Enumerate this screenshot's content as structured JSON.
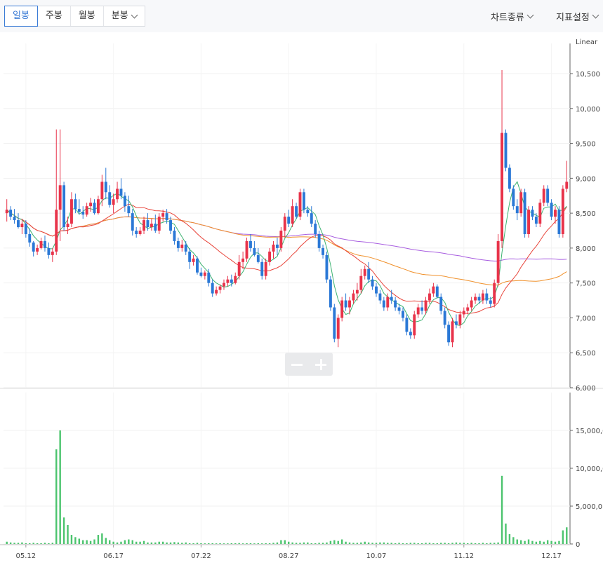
{
  "tabs": [
    {
      "label": "일봉",
      "active": true
    },
    {
      "label": "주봉",
      "active": false
    },
    {
      "label": "월봉",
      "active": false
    },
    {
      "label": "분봉",
      "active": false,
      "dropdown": true
    }
  ],
  "menus": {
    "chart_type": "차트종류",
    "indicator_settings": "지표설정"
  },
  "colors": {
    "up": "#e8334a",
    "down": "#2a78d6",
    "ma5": "#3cb371",
    "ma20": "#e8443a",
    "ma60": "#f0902a",
    "ma120": "#a85ee0",
    "volume": "#4cc46e"
  },
  "chart_data": {
    "type": "candlestick",
    "scale_label": "Linear",
    "price_axis": {
      "min": 6000,
      "max": 10500,
      "ticks": [
        "6,000",
        "6,500",
        "7,000",
        "7,500",
        "8,000",
        "8,500",
        "9,000",
        "9,500",
        "10,000",
        "10,500"
      ]
    },
    "volume_axis": {
      "min": 0,
      "max": 15000,
      "ticks": [
        "0",
        "5,000,0",
        "10,000,0",
        "15,000,0"
      ]
    },
    "x_ticks": [
      "05.12",
      "06.17",
      "07.22",
      "08.27",
      "10.07",
      "11.12",
      "12.17"
    ],
    "candles": [
      [
        8500,
        8700,
        8380,
        8550
      ],
      [
        8550,
        8600,
        8400,
        8450
      ],
      [
        8450,
        8560,
        8350,
        8400
      ],
      [
        8400,
        8500,
        8280,
        8300
      ],
      [
        8300,
        8420,
        8200,
        8350
      ],
      [
        8350,
        8400,
        8150,
        8200
      ],
      [
        8200,
        8280,
        8020,
        8080
      ],
      [
        8080,
        8100,
        7880,
        7950
      ],
      [
        7950,
        8050,
        7900,
        8000
      ],
      [
        8000,
        8150,
        7980,
        8100
      ],
      [
        8100,
        8180,
        7950,
        8000
      ],
      [
        8000,
        8080,
        7850,
        7900
      ],
      [
        7900,
        8000,
        7800,
        7950
      ],
      [
        7950,
        9700,
        7900,
        8550
      ],
      [
        8550,
        9700,
        8100,
        8900
      ],
      [
        8900,
        8950,
        8250,
        8300
      ],
      [
        8300,
        8450,
        8200,
        8350
      ],
      [
        8350,
        8800,
        8300,
        8700
      ],
      [
        8700,
        8780,
        8500,
        8560
      ],
      [
        8560,
        8700,
        8480,
        8520
      ],
      [
        8520,
        8600,
        8420,
        8480
      ],
      [
        8480,
        8650,
        8450,
        8600
      ],
      [
        8600,
        8720,
        8520,
        8650
      ],
      [
        8650,
        8700,
        8480,
        8500
      ],
      [
        8500,
        8750,
        8480,
        8700
      ],
      [
        8700,
        9050,
        8600,
        8950
      ],
      [
        8950,
        9150,
        8700,
        8800
      ],
      [
        8800,
        8900,
        8580,
        8620
      ],
      [
        8620,
        8780,
        8500,
        8700
      ],
      [
        8700,
        8950,
        8650,
        8850
      ],
      [
        8850,
        9000,
        8700,
        8750
      ],
      [
        8750,
        8800,
        8520,
        8600
      ],
      [
        8600,
        8750,
        8450,
        8500
      ],
      [
        8500,
        8560,
        8180,
        8250
      ],
      [
        8250,
        8300,
        8150,
        8200
      ],
      [
        8200,
        8300,
        8180,
        8250
      ],
      [
        8250,
        8450,
        8200,
        8400
      ],
      [
        8400,
        8500,
        8250,
        8300
      ],
      [
        8300,
        8420,
        8250,
        8350
      ],
      [
        8350,
        8480,
        8220,
        8250
      ],
      [
        8250,
        8500,
        8200,
        8450
      ],
      [
        8450,
        8550,
        8380,
        8500
      ],
      [
        8500,
        8560,
        8350,
        8400
      ],
      [
        8400,
        8450,
        8200,
        8250
      ],
      [
        8250,
        8300,
        8050,
        8100
      ],
      [
        8100,
        8150,
        7950,
        8000
      ],
      [
        8000,
        8120,
        7950,
        8050
      ],
      [
        8050,
        8100,
        7900,
        7950
      ],
      [
        7950,
        8000,
        7700,
        7800
      ],
      [
        7800,
        7900,
        7750,
        7850
      ],
      [
        7850,
        7880,
        7620,
        7650
      ],
      [
        7650,
        7720,
        7580,
        7600
      ],
      [
        7600,
        7680,
        7550,
        7650
      ],
      [
        7650,
        7700,
        7450,
        7500
      ],
      [
        7500,
        7550,
        7300,
        7350
      ],
      [
        7350,
        7450,
        7320,
        7400
      ],
      [
        7400,
        7480,
        7350,
        7450
      ],
      [
        7450,
        7550,
        7400,
        7500
      ],
      [
        7500,
        7600,
        7450,
        7550
      ],
      [
        7550,
        7620,
        7450,
        7500
      ],
      [
        7500,
        7650,
        7480,
        7600
      ],
      [
        7600,
        7900,
        7550,
        7800
      ],
      [
        7800,
        7950,
        7700,
        7850
      ],
      [
        7850,
        8150,
        7800,
        8100
      ],
      [
        8100,
        8200,
        7950,
        8000
      ],
      [
        8000,
        8100,
        7880,
        7900
      ],
      [
        7900,
        8000,
        7780,
        7800
      ],
      [
        7800,
        7850,
        7550,
        7600
      ],
      [
        7600,
        7850,
        7550,
        7800
      ],
      [
        7800,
        8000,
        7750,
        7950
      ],
      [
        7950,
        8100,
        7850,
        8050
      ],
      [
        8050,
        8150,
        7900,
        8000
      ],
      [
        8000,
        8300,
        7950,
        8250
      ],
      [
        8250,
        8500,
        8150,
        8450
      ],
      [
        8450,
        8550,
        8300,
        8350
      ],
      [
        8350,
        8700,
        8300,
        8600
      ],
      [
        8600,
        8650,
        8420,
        8450
      ],
      [
        8450,
        8850,
        8400,
        8800
      ],
      [
        8800,
        8850,
        8500,
        8550
      ],
      [
        8550,
        8600,
        8450,
        8500
      ],
      [
        8500,
        8600,
        8300,
        8350
      ],
      [
        8350,
        8400,
        8150,
        8200
      ],
      [
        8200,
        8250,
        7950,
        8000
      ],
      [
        8000,
        8050,
        7850,
        7900
      ],
      [
        7900,
        7950,
        7500,
        7550
      ],
      [
        7550,
        7600,
        7100,
        7150
      ],
      [
        7150,
        7200,
        6650,
        6700
      ],
      [
        6700,
        7050,
        6580,
        7000
      ],
      [
        7000,
        7300,
        6950,
        7250
      ],
      [
        7250,
        7350,
        7100,
        7150
      ],
      [
        7150,
        7300,
        7050,
        7250
      ],
      [
        7250,
        7400,
        7200,
        7350
      ],
      [
        7350,
        7500,
        7250,
        7400
      ],
      [
        7400,
        7700,
        7350,
        7600
      ],
      [
        7600,
        7750,
        7550,
        7700
      ],
      [
        7700,
        7800,
        7500,
        7550
      ],
      [
        7550,
        7600,
        7400,
        7450
      ],
      [
        7450,
        7500,
        7300,
        7350
      ],
      [
        7350,
        7400,
        7200,
        7250
      ],
      [
        7250,
        7300,
        7100,
        7150
      ],
      [
        7150,
        7350,
        7100,
        7300
      ],
      [
        7300,
        7400,
        7200,
        7250
      ],
      [
        7250,
        7300,
        7100,
        7150
      ],
      [
        7150,
        7200,
        7050,
        7100
      ],
      [
        7100,
        7150,
        6950,
        7000
      ],
      [
        7000,
        7050,
        6750,
        6800
      ],
      [
        6800,
        6850,
        6700,
        6750
      ],
      [
        6750,
        7100,
        6700,
        7050
      ],
      [
        7050,
        7200,
        7000,
        7150
      ],
      [
        7150,
        7250,
        7050,
        7100
      ],
      [
        7100,
        7300,
        7050,
        7250
      ],
      [
        7250,
        7420,
        7200,
        7350
      ],
      [
        7350,
        7500,
        7300,
        7450
      ],
      [
        7450,
        7480,
        7280,
        7300
      ],
      [
        7300,
        7350,
        7050,
        7100
      ],
      [
        7100,
        7150,
        6850,
        6900
      ],
      [
        6900,
        6950,
        6600,
        6650
      ],
      [
        6650,
        7000,
        6580,
        6950
      ],
      [
        6950,
        7050,
        6850,
        6900
      ],
      [
        6900,
        7100,
        6850,
        7050
      ],
      [
        7050,
        7150,
        7000,
        7100
      ],
      [
        7100,
        7200,
        7050,
        7150
      ],
      [
        7150,
        7300,
        7100,
        7250
      ],
      [
        7250,
        7350,
        7200,
        7300
      ],
      [
        7300,
        7350,
        7200,
        7250
      ],
      [
        7250,
        7400,
        7200,
        7350
      ],
      [
        7350,
        7420,
        7200,
        7250
      ],
      [
        7250,
        7300,
        7150,
        7200
      ],
      [
        7200,
        7550,
        7150,
        7500
      ],
      [
        7500,
        8200,
        7450,
        8100
      ],
      [
        8100,
        10550,
        8000,
        9650
      ],
      [
        9650,
        9700,
        9100,
        9150
      ],
      [
        9150,
        9200,
        8800,
        8850
      ],
      [
        8850,
        8900,
        8550,
        8600
      ],
      [
        8600,
        8700,
        8400,
        8500
      ],
      [
        8500,
        8850,
        8450,
        8800
      ],
      [
        8800,
        8850,
        8150,
        8200
      ],
      [
        8200,
        8600,
        8150,
        8550
      ],
      [
        8550,
        8600,
        8400,
        8450
      ],
      [
        8450,
        8500,
        8300,
        8350
      ],
      [
        8350,
        8700,
        8300,
        8650
      ],
      [
        8650,
        8900,
        8600,
        8850
      ],
      [
        8850,
        8900,
        8600,
        8650
      ],
      [
        8650,
        8700,
        8400,
        8450
      ],
      [
        8450,
        8600,
        8350,
        8550
      ],
      [
        8550,
        8600,
        8150,
        8200
      ],
      [
        8200,
        8900,
        8150,
        8850
      ],
      [
        8850,
        9250,
        8800,
        8950
      ]
    ],
    "volume": [
      300,
      200,
      150,
      150,
      200,
      100,
      100,
      150,
      100,
      100,
      150,
      100,
      150,
      12500,
      15000,
      3500,
      2500,
      1200,
      900,
      700,
      500,
      500,
      400,
      600,
      1200,
      1400,
      800,
      500,
      300,
      200,
      300,
      500,
      600,
      500,
      300,
      300,
      400,
      200,
      200,
      200,
      300,
      300,
      200,
      200,
      250,
      200,
      150,
      200,
      100,
      100,
      150,
      100,
      80,
      100,
      100,
      80,
      100,
      80,
      80,
      100,
      100,
      120,
      80,
      100,
      100,
      80,
      100,
      80,
      100,
      100,
      150,
      200,
      500,
      500,
      300,
      200,
      150,
      150,
      200,
      200,
      100,
      100,
      150,
      150,
      200,
      400,
      500,
      400,
      600,
      300,
      200,
      150,
      150,
      200,
      300,
      200,
      150,
      150,
      200,
      200,
      150,
      150,
      100,
      150,
      100,
      100,
      150,
      150,
      100,
      100,
      150,
      150,
      100,
      100,
      150,
      150,
      100,
      150,
      200,
      150,
      150,
      100,
      150,
      100,
      100,
      150,
      100,
      150,
      150,
      200,
      9000,
      2700,
      1300,
      900,
      600,
      500,
      400,
      600,
      400,
      300,
      400,
      300,
      500,
      400,
      300,
      400,
      1800,
      2200
    ]
  }
}
